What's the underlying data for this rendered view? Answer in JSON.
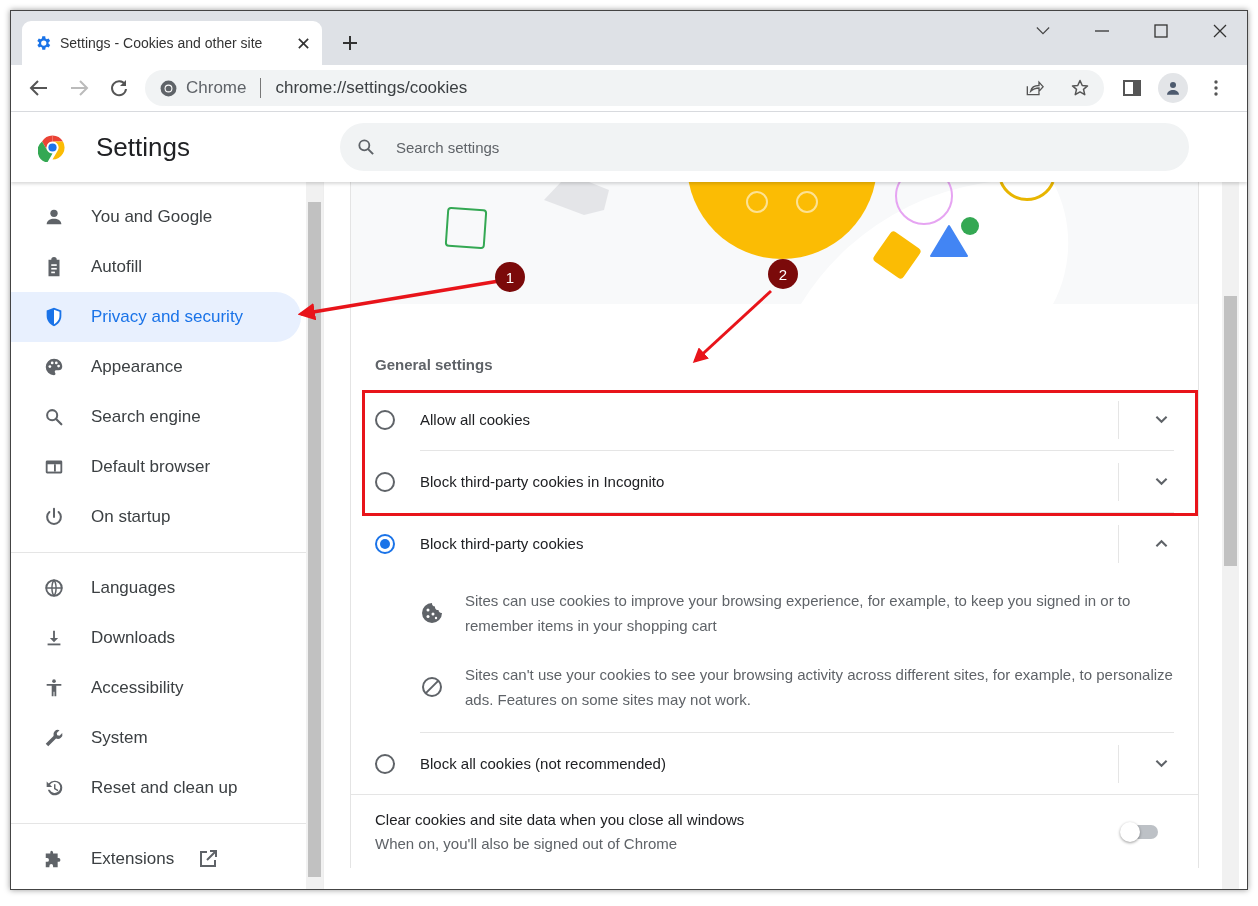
{
  "browser": {
    "tab_title": "Settings - Cookies and other site",
    "omnibox": {
      "origin": "Chrome",
      "url": "chrome://settings/cookies"
    }
  },
  "header": {
    "title": "Settings",
    "search": {
      "placeholder": "Search settings"
    }
  },
  "sidebar": {
    "sections": [
      {
        "items": [
          {
            "label": "You and Google",
            "selected": false
          },
          {
            "label": "Autofill",
            "selected": false
          },
          {
            "label": "Privacy and security",
            "selected": true
          },
          {
            "label": "Appearance",
            "selected": false
          },
          {
            "label": "Search engine",
            "selected": false
          },
          {
            "label": "Default browser",
            "selected": false
          },
          {
            "label": "On startup",
            "selected": false
          }
        ]
      },
      {
        "items": [
          {
            "label": "Languages",
            "selected": false
          },
          {
            "label": "Downloads",
            "selected": false
          },
          {
            "label": "Accessibility",
            "selected": false
          },
          {
            "label": "System",
            "selected": false
          },
          {
            "label": "Reset and clean up",
            "selected": false
          }
        ]
      },
      {
        "items": [
          {
            "label": "Extensions",
            "selected": false
          }
        ]
      }
    ]
  },
  "general_settings": {
    "heading": "General settings",
    "options": [
      {
        "label": "Allow all cookies",
        "selected": false,
        "expanded": false
      },
      {
        "label": "Block third-party cookies in Incognito",
        "selected": false,
        "expanded": false
      },
      {
        "label": "Block third-party cookies",
        "selected": true,
        "expanded": true,
        "details": [
          {
            "kind": "cookie",
            "text": "Sites can use cookies to improve your browsing experience, for example, to keep you signed in or to remember items in your shopping cart"
          },
          {
            "kind": "blocked",
            "text": "Sites can't use your cookies to see your browsing activity across different sites, for example, to personalize ads. Features on some sites may not work."
          }
        ]
      },
      {
        "label": "Block all cookies (not recommended)",
        "selected": false,
        "expanded": false
      }
    ],
    "clear_on_exit": {
      "label": "Clear cookies and site data when you close all windows",
      "sublabel": "When on, you'll also be signed out of Chrome",
      "on": false
    }
  },
  "annotations": [
    {
      "label": "1"
    },
    {
      "label": "2"
    }
  ]
}
